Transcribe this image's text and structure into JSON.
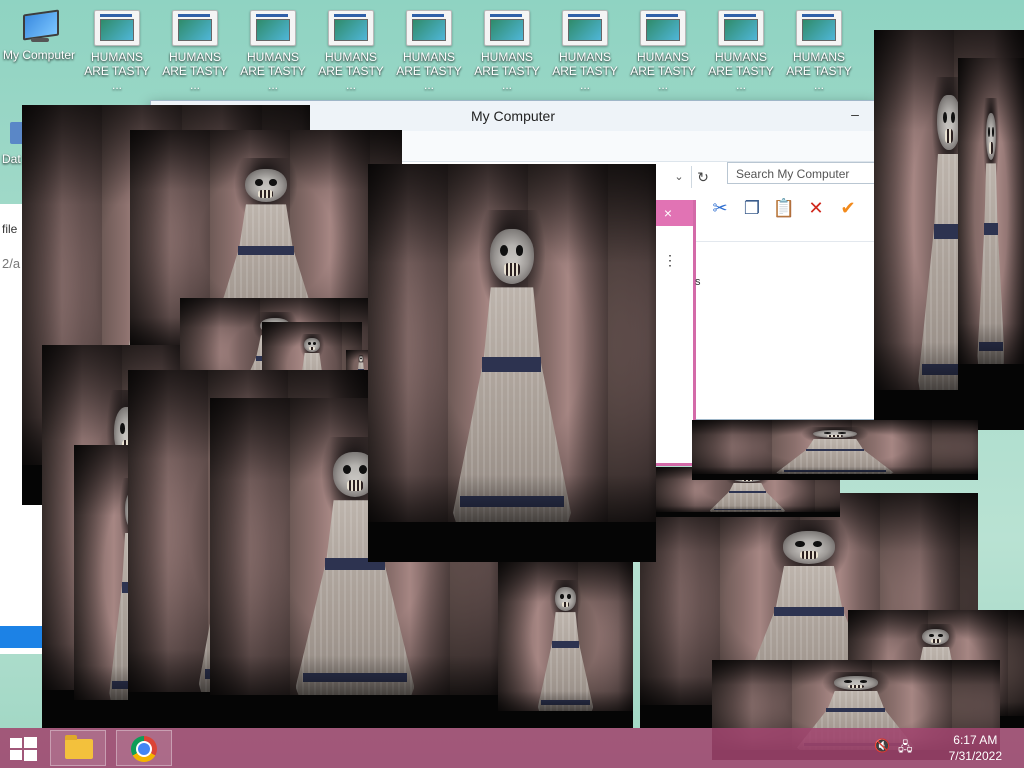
{
  "desktop": {
    "icons": [
      {
        "label": "My Computer",
        "type": "computer"
      },
      {
        "label": "HUMANS ARE TASTY ...",
        "type": "file"
      },
      {
        "label": "HUMANS ARE TASTY ...",
        "type": "file"
      },
      {
        "label": "HUMANS ARE TASTY ...",
        "type": "file"
      },
      {
        "label": "HUMANS ARE TASTY ...",
        "type": "file"
      },
      {
        "label": "HUMANS ARE TASTY ...",
        "type": "file"
      },
      {
        "label": "HUMANS ARE TASTY ...",
        "type": "file"
      },
      {
        "label": "HUMANS ARE TASTY ...",
        "type": "file"
      },
      {
        "label": "HUMANS ARE TASTY ...",
        "type": "file"
      },
      {
        "label": "HUMANS ARE TASTY ...",
        "type": "file"
      },
      {
        "label": "HUMANS ARE TASTY ...",
        "type": "file"
      }
    ],
    "partial_icon_label": "Dat"
  },
  "explorer": {
    "title": "My Computer",
    "search_placeholder": "Search My Computer",
    "minimize_glyph": "–",
    "refresh_glyph": "↻",
    "dropdown_glyph": "⌄"
  },
  "pink_window": {
    "close_glyph": "×",
    "menu_glyph": "⋮",
    "fragment_text": "s"
  },
  "left_window": {
    "text_line1": "file",
    "text_line2": "2/a"
  },
  "toolbar_icons": [
    {
      "name": "cut-icon",
      "glyph": "✂",
      "color": "#2f6fd1"
    },
    {
      "name": "copy-icon",
      "glyph": "❐",
      "color": "#3a5c8c"
    },
    {
      "name": "paste-icon",
      "glyph": "📋",
      "color": "#b77a20"
    },
    {
      "name": "delete-icon",
      "glyph": "✕",
      "color": "#d0281c"
    },
    {
      "name": "check-icon",
      "glyph": "✔",
      "color": "#f28a1c"
    }
  ],
  "taskbar": {
    "time": "6:17 AM",
    "date": "7/31/2022",
    "volume_glyph": "🔇",
    "network_glyph": "🖧"
  }
}
